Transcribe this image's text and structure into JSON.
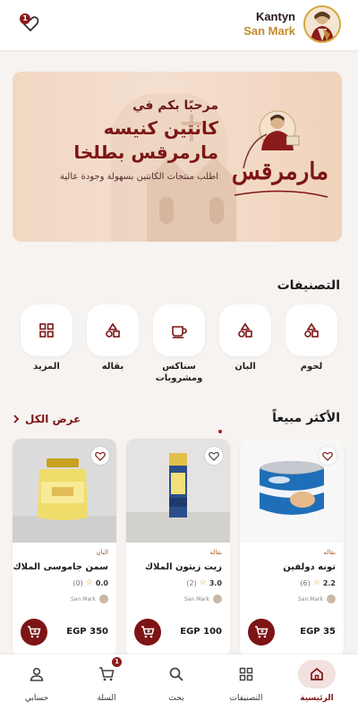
{
  "header": {
    "brand_line1": "Kantyn",
    "brand_line2": "San Mark",
    "notification_count": "1",
    "notification_icon": "heart-bell-icon"
  },
  "banner": {
    "welcome": "مرحبًا بكم في",
    "title_line1": "كانتين كنيسه",
    "title_line2": "مارمرقس بطلخا",
    "subtitle": "اطلب منتجات الكانتين بسهولة وجودة عالية",
    "logo_text": "كنيسة مارمرقس بطلخا"
  },
  "categories": {
    "title": "التصنيفات",
    "items": [
      {
        "label": "لحوم",
        "icon": "shapes-icon"
      },
      {
        "label": "البان",
        "icon": "shapes-icon"
      },
      {
        "label": "سناكس ومشروبات",
        "icon": "cup-icon"
      },
      {
        "label": "بقاله",
        "icon": "shapes-icon"
      },
      {
        "label": "المزيد",
        "icon": "grid-icon"
      }
    ]
  },
  "best_sellers": {
    "title": "الأكثر مبيعاً",
    "see_all": "عرض الكل",
    "products": [
      {
        "category": "بقاله",
        "name": "تونه دولفين",
        "rating": "2.2",
        "reviews": "(6)",
        "seller": "San Mark",
        "price": "EGP 35"
      },
      {
        "category": "بقاله",
        "name": "زيت زيتون الملاك",
        "rating": "3.0",
        "reviews": "(2)",
        "seller": "San Mark",
        "price": "EGP 100"
      },
      {
        "category": "البان",
        "name": "سمن جاموسى الملاك",
        "rating": "0.0",
        "reviews": "(0)",
        "seller": "San Mark",
        "price": "EGP 350"
      }
    ]
  },
  "bottom_nav": {
    "items": [
      {
        "label": "الرئيسية",
        "icon": "home-icon",
        "active": true
      },
      {
        "label": "التصنيفات",
        "icon": "grid-icon",
        "active": false
      },
      {
        "label": "بحث",
        "icon": "search-icon",
        "active": false
      },
      {
        "label": "السلة",
        "icon": "cart-icon",
        "active": false,
        "badge": "1"
      },
      {
        "label": "حسابي",
        "icon": "user-icon",
        "active": false
      }
    ]
  },
  "colors": {
    "primary": "#7d1515",
    "accent_gold": "#c48a2c",
    "background": "#f6f3f1"
  }
}
